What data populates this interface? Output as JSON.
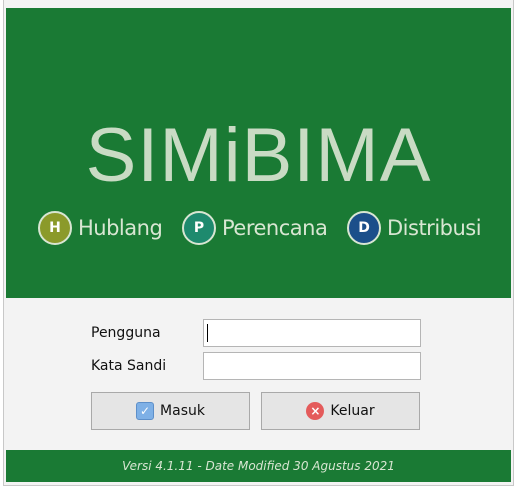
{
  "app": {
    "title": "SIMiBIMA",
    "modules": [
      {
        "badge": "H",
        "label": "Hublang",
        "icon": "hublang-badge-icon"
      },
      {
        "badge": "P",
        "label": "Perencana",
        "icon": "perencana-badge-icon"
      },
      {
        "badge": "D",
        "label": "Distribusi",
        "icon": "distribusi-badge-icon"
      }
    ]
  },
  "form": {
    "username_label": "Pengguna",
    "username_value": "",
    "password_label": "Kata Sandi",
    "password_value": "",
    "login_button": "Masuk",
    "exit_button": "Keluar"
  },
  "footer": {
    "version_text": "Versi 4.1.11 - Date Modified 30 Agustus 2021"
  },
  "colors": {
    "brand_green": "#1a7a34",
    "title_text": "#c9dbc4",
    "form_bg": "#f3f3f3"
  }
}
